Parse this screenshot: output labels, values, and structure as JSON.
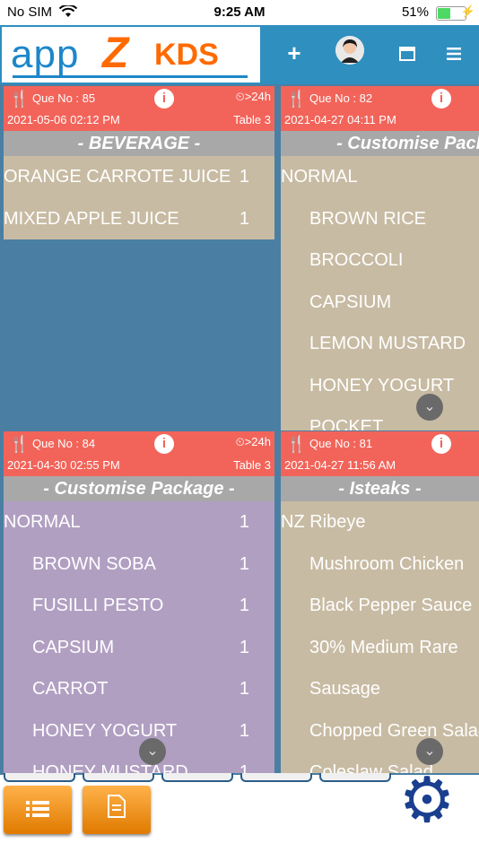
{
  "status_bar": {
    "carrier": "No SIM",
    "time": "9:25 AM",
    "battery_pct": "51%",
    "battery_level": 0.51
  },
  "header": {
    "logo_app": "app",
    "logo_z": "Z",
    "logo_kds": "KDS"
  },
  "colors": {
    "accent": "#2f8fbf",
    "card_header": "#f2645a",
    "category_bar": "#a8a8a8",
    "beige": "#c8bba3",
    "purple": "#b19fc2",
    "orange": "#f39a1b",
    "gear": "#1a3f8f"
  },
  "orders": [
    {
      "que": "Que No : 85",
      "timer": "⏲>24h",
      "date": "2021-05-06 02:12 PM",
      "table": "Table 3",
      "category": "- BEVERAGE -",
      "items": [
        {
          "name": "ORANGE CARROTE JUICE",
          "qty": "1"
        },
        {
          "name": "MIXED APPLE JUICE",
          "qty": "1"
        }
      ]
    },
    {
      "que": "Que No : 82",
      "timer": "",
      "date": "2021-04-27 04:11 PM",
      "table": "",
      "category": "- Customise Packa",
      "items": [
        {
          "name": "NORMAL"
        },
        {
          "name": "BROWN RICE"
        },
        {
          "name": "BROCCOLI"
        },
        {
          "name": "CAPSIUM"
        },
        {
          "name": "LEMON MUSTARD"
        },
        {
          "name": "HONEY YOGURT"
        },
        {
          "name": "POCKET"
        }
      ]
    },
    {
      "que": "Que No : 84",
      "timer": "⏲>24h",
      "date": "2021-04-30 02:55 PM",
      "table": "Table 3",
      "category": "- Customise Package -",
      "items": [
        {
          "name": "NORMAL",
          "qty": "1"
        },
        {
          "name": "BROWN SOBA",
          "qty": "1"
        },
        {
          "name": "FUSILLI PESTO",
          "qty": "1"
        },
        {
          "name": "CAPSIUM",
          "qty": "1"
        },
        {
          "name": "CARROT",
          "qty": "1"
        },
        {
          "name": "HONEY YOGURT",
          "qty": "1"
        },
        {
          "name": "HONEY MUSTARD",
          "qty": "1"
        }
      ]
    },
    {
      "que": "Que No : 81",
      "timer": "",
      "date": "2021-04-27 11:56 AM",
      "table": "",
      "category": "- Isteaks -",
      "items": [
        {
          "name": "NZ Ribeye"
        },
        {
          "name": "Mushroom Chicken"
        },
        {
          "name": "Black Pepper Sauce"
        },
        {
          "name": "30% Medium Rare"
        },
        {
          "name": "Sausage"
        },
        {
          "name": "Chopped Green Salad"
        },
        {
          "name": "Coleslaw Salad"
        }
      ]
    }
  ],
  "icons": {
    "add": "plus-icon",
    "avatar": "avatar",
    "window": "window-icon",
    "menu": "hamburger-icon",
    "forks": "fork-knife-icon",
    "info": "info-icon",
    "scroll": "chevron-down-icon",
    "list": "list-icon",
    "doc": "document-icon",
    "gear": "gear-icon"
  }
}
